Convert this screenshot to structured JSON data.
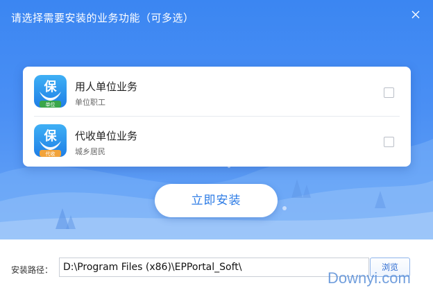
{
  "window": {
    "title": "请选择需要安装的业务功能（可多选）"
  },
  "options": [
    {
      "name": "用人单位业务",
      "description": "单位职工",
      "icon_glyph": "保",
      "icon_badge": "单位",
      "checked": false
    },
    {
      "name": "代收单位业务",
      "description": "城乡居民",
      "icon_glyph": "保",
      "icon_badge": "代收",
      "checked": false
    }
  ],
  "install_button": {
    "label": "立即安装"
  },
  "install_path": {
    "label": "安装路径：",
    "value": "D:\\Program Files (x86)\\EPPortal_Soft\\"
  },
  "browse_button": {
    "label": "浏览"
  },
  "watermark": {
    "text": "Downyi.com"
  },
  "colors": {
    "header_blue": "#3b86f2",
    "accent_text": "#2c7be5",
    "badge_green": "#3aa64a",
    "badge_orange": "#f2a33a"
  }
}
